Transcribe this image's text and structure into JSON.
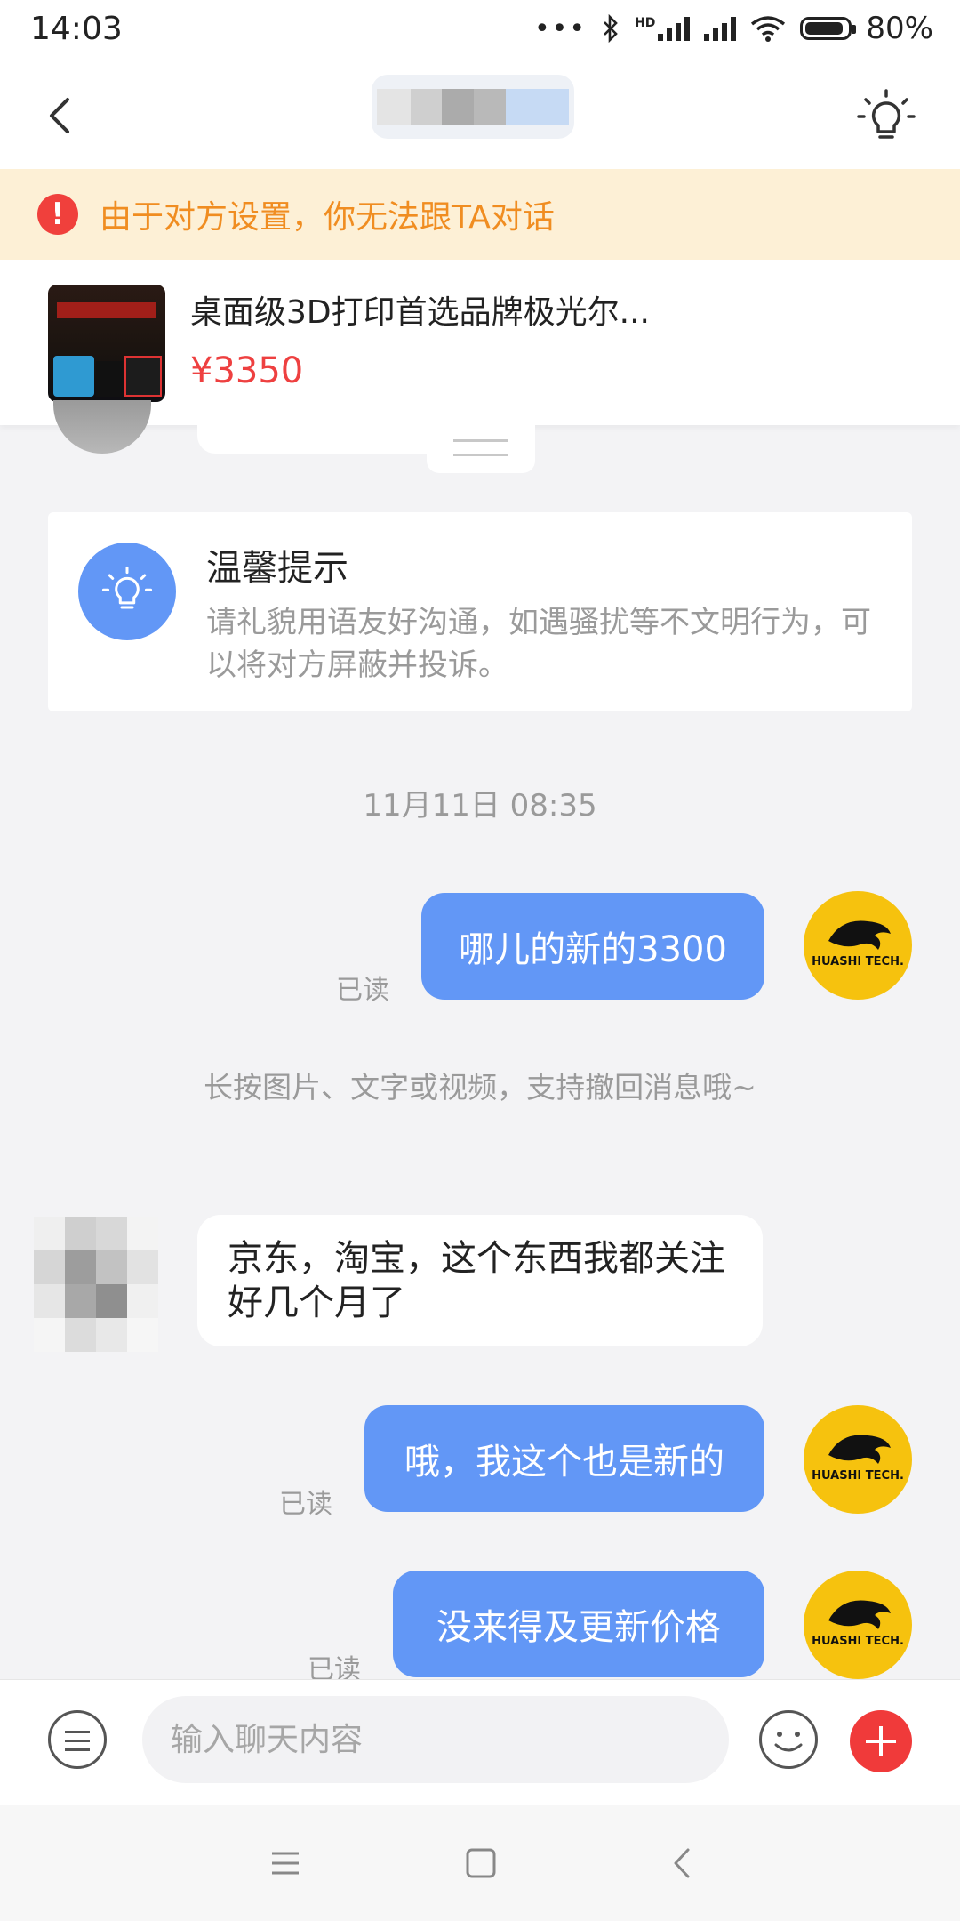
{
  "status_bar": {
    "time": "14:03",
    "network_label": "HD",
    "battery": "80%"
  },
  "header": {
    "title_redacted": true,
    "back_icon": "chevron-left-icon",
    "action_icon": "lightbulb-icon"
  },
  "banner": {
    "icon": "exclamation-icon",
    "text": "由于对方设置，你无法跟TA对话",
    "color": "#f08d21"
  },
  "product": {
    "title": "桌面级3D打印首选品牌极光尔...",
    "price": "¥3350"
  },
  "tip": {
    "title": "温馨提示",
    "body": "请礼貌用语友好沟通，如遇骚扰等不文明行为，可以将对方屏蔽并投诉。"
  },
  "chat": {
    "timestamp": "11月11日 08:35",
    "messages": [
      {
        "side": "out",
        "text": "哪儿的新的3300",
        "status": "已读"
      },
      {
        "side": "in",
        "text": "京东，淘宝，这个东西我都关注好几个月了"
      },
      {
        "side": "out",
        "text": "哦，我这个也是新的",
        "status": "已读"
      },
      {
        "side": "out",
        "text": "没来得及更新价格",
        "status": "已读"
      }
    ],
    "notice": "长按图片、文字或视频，支持撤回消息哦~",
    "my_avatar_text": "HUASHI TECH."
  },
  "input": {
    "placeholder": "输入聊天内容"
  },
  "colors": {
    "accent_blue": "#6297f6",
    "price_red": "#ee4040",
    "banner_bg": "#fdf0d6",
    "plus_red": "#f03a3a",
    "avatar_yellow": "#f6c20e"
  }
}
